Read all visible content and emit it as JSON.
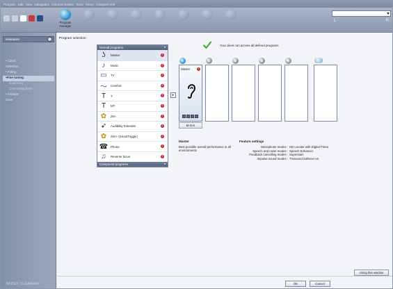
{
  "menubar": [
    "Program",
    "Edit",
    "View",
    "Navigation",
    "Communication",
    "Tools",
    "Setup",
    "Compare test"
  ],
  "toolbar": {
    "buttons": [
      {
        "label": "Program manager",
        "active": true
      },
      {
        "label": "",
        "active": false
      },
      {
        "label": "",
        "active": false
      },
      {
        "label": "",
        "active": false
      },
      {
        "label": "",
        "active": false
      },
      {
        "label": "",
        "active": false
      },
      {
        "label": "",
        "active": false
      },
      {
        "label": "",
        "active": false
      }
    ],
    "right_field_value": ""
  },
  "sidebar": {
    "header": "Hearware",
    "items": [
      {
        "label": "• Client",
        "active": false,
        "sub": false
      },
      {
        "label": "Selection",
        "active": false,
        "sub": false
      },
      {
        "label": "• Fitting",
        "active": false,
        "sub": false
      },
      {
        "label": "•Fine tuning",
        "active": true,
        "sub": false
      },
      {
        "label": "Gain/Freq",
        "active": false,
        "sub": true
      },
      {
        "label": "Counseling tools",
        "active": false,
        "sub": true
      },
      {
        "label": "• Finalize",
        "active": false,
        "sub": false
      },
      {
        "label": "Save",
        "active": false,
        "sub": false
      }
    ],
    "footer": "WIDEX CLEAR440"
  },
  "main": {
    "title": "Program selection",
    "access_message": "Your client can access all defined programs",
    "normal_header": "Normal programs",
    "compound_header": "Compound programs",
    "programs": [
      {
        "name": "Master",
        "icon": "ear-icon",
        "selected": true
      },
      {
        "name": "Music",
        "icon": "music-note-icon",
        "selected": false
      },
      {
        "name": "TV",
        "icon": "tv-icon",
        "selected": false
      },
      {
        "name": "Comfort",
        "icon": "comfort-icon",
        "selected": false
      },
      {
        "name": "T",
        "icon": "telecoil-icon",
        "selected": false
      },
      {
        "name": "MT",
        "icon": "telecoil-mic-icon",
        "selected": false
      },
      {
        "name": "Zen",
        "icon": "zen-icon",
        "selected": false
      },
      {
        "name": "Audibility Extender",
        "icon": "bird-icon",
        "selected": false
      },
      {
        "name": "Zen+ (SmartToggle)",
        "icon": "zen-plus-icon",
        "selected": false
      },
      {
        "name": "Phone",
        "icon": "phone-icon",
        "selected": false
      },
      {
        "name": "Reverse focus",
        "icon": "reverse-focus-icon",
        "selected": false
      }
    ],
    "slots": [
      {
        "num": "1",
        "label": "Master",
        "filled": true
      },
      {
        "num": "2",
        "label": "",
        "filled": false
      },
      {
        "num": "3",
        "label": "",
        "filled": false
      },
      {
        "num": "4",
        "label": "",
        "filled": false
      },
      {
        "num": "5",
        "label": "",
        "filled": false
      },
      {
        "num": "",
        "label": "",
        "filled": false
      }
    ],
    "mgain_label": "M-GAI",
    "description": {
      "title": "Master",
      "text": "Best possible overall performance in all environments"
    },
    "features": {
      "title": "Feature settings",
      "rows": [
        {
          "key": "Microphone modes :",
          "value": "HD Locator with Digital Pinna"
        },
        {
          "key": "Speech and noise modes :",
          "value": "Speech Enhancer"
        },
        {
          "key": "Feedback cancelling modes :",
          "value": "SuperGain"
        },
        {
          "key": "Impulse sound modes :",
          "value": "TruSound Softener on"
        }
      ]
    },
    "using_window_label": "Using this window",
    "ok_label": "OK",
    "cancel_label": "Cancel"
  },
  "colors": {
    "accent": "#2f8fc9",
    "info_badge": "#c0262d",
    "check": "#3aa83a"
  }
}
